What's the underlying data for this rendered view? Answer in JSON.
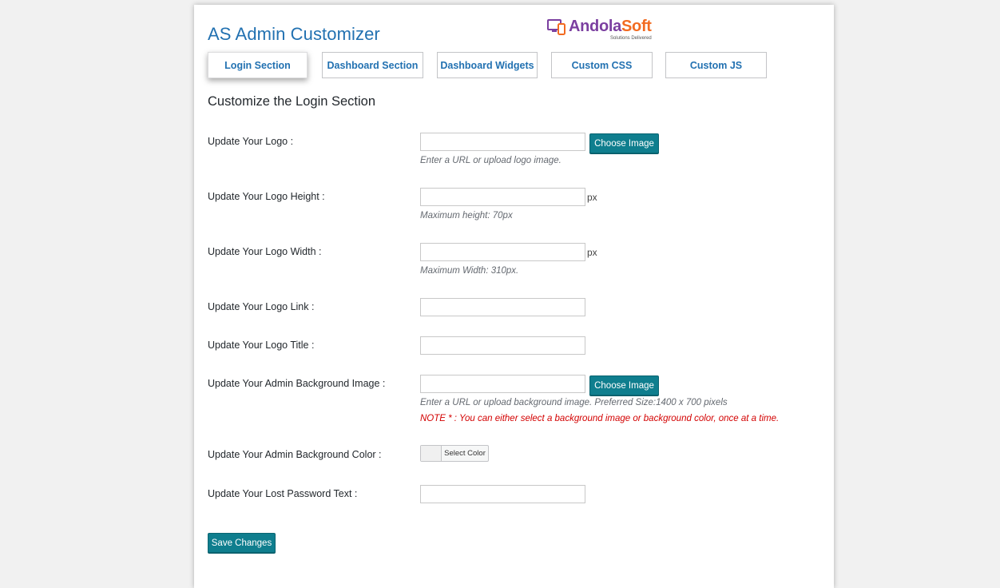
{
  "app": {
    "title": "AS Admin Customizer",
    "brand": {
      "name_part1": "Andola",
      "name_part2": "Soft",
      "tagline": "Solutions Delivered"
    }
  },
  "tabs": [
    {
      "label": "Login Section",
      "active": true
    },
    {
      "label": "Dashboard Section",
      "active": false
    },
    {
      "label": "Dashboard Widgets",
      "active": false
    },
    {
      "label": "Custom CSS",
      "active": false
    },
    {
      "label": "Custom JS",
      "active": false
    }
  ],
  "section": {
    "heading": "Customize the Login Section"
  },
  "fields": {
    "logo": {
      "label": "Update Your Logo :",
      "value": "",
      "button": "Choose Image",
      "hint": "Enter a URL or upload logo image."
    },
    "logo_height": {
      "label": "Update Your Logo Height :",
      "value": "",
      "unit": "px",
      "hint": "Maximum height: 70px"
    },
    "logo_width": {
      "label": "Update Your Logo Width :",
      "value": "",
      "unit": "px",
      "hint": "Maximum Width: 310px."
    },
    "logo_link": {
      "label": "Update Your Logo Link :",
      "value": ""
    },
    "logo_title": {
      "label": "Update Your Logo Title :",
      "value": ""
    },
    "bg_image": {
      "label": "Update Your Admin Background Image :",
      "value": "",
      "button": "Choose Image",
      "hint": "Enter a URL or upload background image. Preferred Size:1400 x 700 pixels",
      "note": "NOTE * : You can either select a background image or background color, once at a time."
    },
    "bg_color": {
      "label": "Update Your Admin Background Color :",
      "button": "Select Color"
    },
    "lost_password": {
      "label": "Update Your Lost Password Text :",
      "value": ""
    }
  },
  "actions": {
    "save_label": "Save Changes"
  },
  "colors": {
    "accent_blue": "#2271b1",
    "button_teal": "#0f7e8e",
    "note_red": "#d30000",
    "brand_purple": "#7b3fa0",
    "brand_orange": "#f26b21"
  }
}
